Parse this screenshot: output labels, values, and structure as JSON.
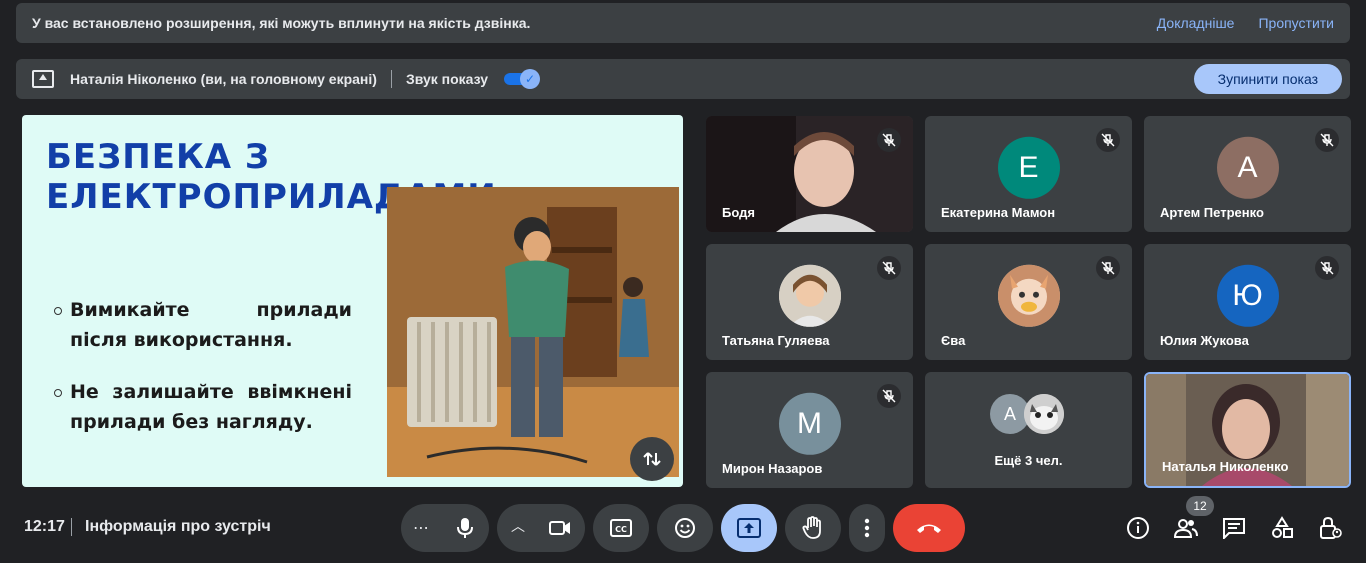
{
  "banner_extensions": {
    "message": "У вас встановлено розширення, які можуть вплинути на якість дзвінка.",
    "details_link": "Докладніше",
    "skip_link": "Пропустити"
  },
  "presentation_bar": {
    "presenter": "Наталія Ніколенко (ви, на головному екрані)",
    "sound_label": "Звук показу",
    "sound_on": true,
    "stop_button": "Зупинити показ"
  },
  "slide": {
    "title": "БЕЗПЕКА З ЕЛЕКТРОПРИЛАДАМИ",
    "bullets": [
      "Вимикайте прилади після використання.",
      "Не залишайте ввімкнені прилади без нагляду."
    ]
  },
  "participants": [
    {
      "name": "Бодя",
      "initial": "",
      "color": "",
      "muted": true
    },
    {
      "name": "Екатерина Мамон",
      "initial": "Е",
      "color": "#00897b",
      "muted": true
    },
    {
      "name": "Артем Петренко",
      "initial": "А",
      "color": "#8d6e63",
      "muted": true
    },
    {
      "name": "Татьяна Гуляева",
      "initial": "",
      "color": "",
      "muted": true
    },
    {
      "name": "Єва",
      "initial": "",
      "color": "",
      "muted": true
    },
    {
      "name": "Юлия Жукова",
      "initial": "Ю",
      "color": "#1565c0",
      "muted": true
    },
    {
      "name": "Мирон Назаров",
      "initial": "М",
      "color": "#78909c",
      "muted": true
    },
    {
      "name": "Наталья Николенко",
      "initial": "",
      "color": "",
      "muted": false
    }
  ],
  "more_tile": {
    "initial": "А",
    "label": "Ещё 3 чел."
  },
  "bottom_bar": {
    "time": "12:17",
    "meeting_info": "Інформація про зустріч",
    "people_count": "12"
  },
  "colors": {
    "background": "#202124",
    "tile": "#3c4043",
    "accent": "#8ab4f8",
    "end_call": "#ea4335",
    "present_active": "#a8c7fa"
  }
}
